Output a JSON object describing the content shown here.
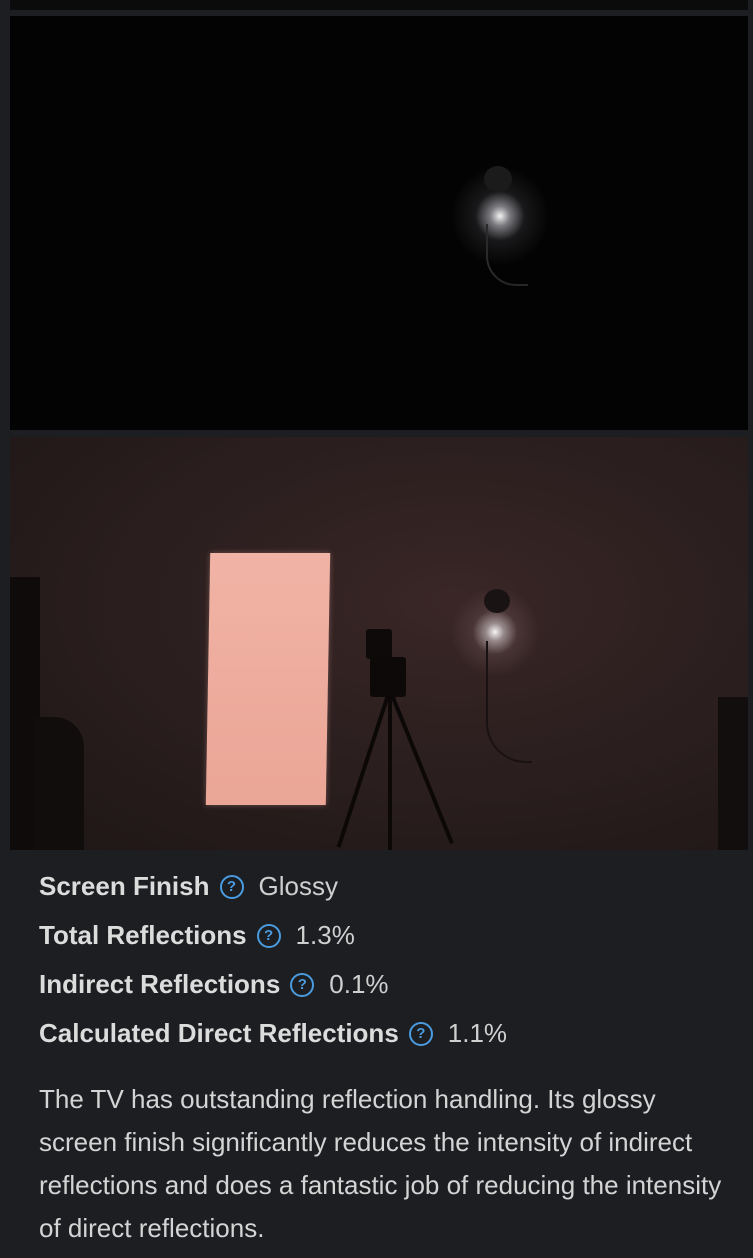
{
  "photos": {
    "dark_alt": "",
    "lit_alt": ""
  },
  "specs": [
    {
      "label": "Screen Finish",
      "value": "Glossy",
      "icon": "help-circle-icon"
    },
    {
      "label": "Total Reflections",
      "value": "1.3%",
      "icon": "help-circle-icon"
    },
    {
      "label": "Indirect Reflections",
      "value": "0.1%",
      "icon": "help-circle-icon"
    },
    {
      "label": "Calculated Direct Reflections",
      "value": "1.1%",
      "icon": "help-circle-icon"
    }
  ],
  "help_glyph": "?",
  "description": "The TV has outstanding reflection handling. Its glossy screen finish significantly reduces the intensity of indirect reflections and does a fantastic job of reducing the intensity of direct reflections.",
  "colors": {
    "background": "#1c1e21",
    "accent": "#4a9be0",
    "text": "#d4d4d4"
  }
}
